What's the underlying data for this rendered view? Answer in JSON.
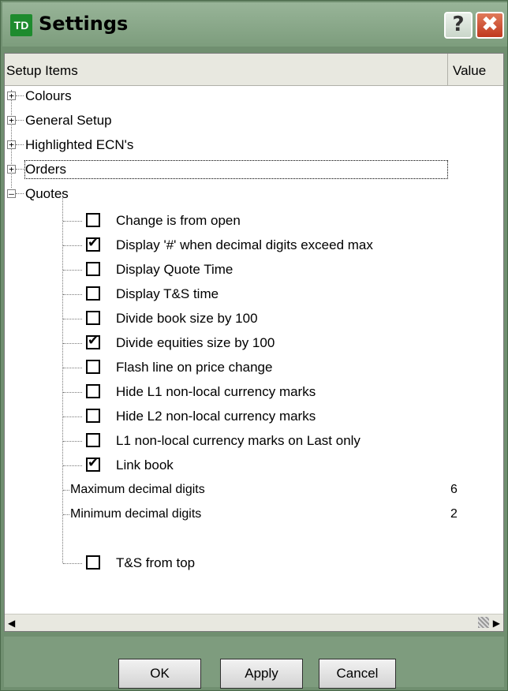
{
  "window": {
    "logo": "TD",
    "title": "Settings",
    "help_label": "?",
    "close_label": "✖"
  },
  "columns": {
    "setup_items": "Setup Items",
    "value": "Value"
  },
  "categories": [
    {
      "label": "Colours",
      "expanded": false
    },
    {
      "label": "General Setup",
      "expanded": false
    },
    {
      "label": "Highlighted ECN's",
      "expanded": false
    },
    {
      "label": "Orders",
      "expanded": false,
      "focused": true
    },
    {
      "label": "Quotes",
      "expanded": true
    }
  ],
  "quotes_items": [
    {
      "label": "Change is from open",
      "checked": false
    },
    {
      "label": "Display '#' when decimal digits exceed max",
      "checked": true
    },
    {
      "label": "Display Quote Time",
      "checked": false
    },
    {
      "label": "Display T&S time",
      "checked": false
    },
    {
      "label": "Divide book size by 100",
      "checked": false
    },
    {
      "label": "Divide equities size by 100",
      "checked": true
    },
    {
      "label": "Flash line on price change",
      "checked": false
    },
    {
      "label": "Hide L1 non-local currency marks",
      "checked": false
    },
    {
      "label": "Hide L2 non-local currency marks",
      "checked": false
    },
    {
      "label": "L1 non-local currency marks on Last only",
      "checked": false
    },
    {
      "label": "Link book",
      "checked": true
    }
  ],
  "numeric_items": [
    {
      "label": "Maximum decimal digits",
      "value": "6"
    },
    {
      "label": "Minimum decimal digits",
      "value": "2"
    }
  ],
  "last_item": {
    "label": "T&S from top",
    "checked": false
  },
  "buttons": {
    "ok": "OK",
    "apply": "Apply",
    "cancel": "Cancel"
  },
  "colors": {
    "window_bg": "#708f70",
    "check_color": "#000000"
  },
  "icons": {
    "scroll_left": "scroll-left-arrow-icon",
    "scroll_right": "scroll-right-arrow-icon"
  }
}
